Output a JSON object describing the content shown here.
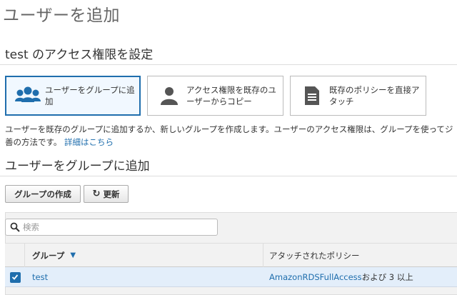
{
  "page": {
    "title": "ユーザーを追加"
  },
  "permissions": {
    "section_title": "test のアクセス権限を設定",
    "options": [
      {
        "label": "ユーザーをグループに追加",
        "icon": "users-group-icon",
        "selected": true
      },
      {
        "label": "アクセス権限を既存のユーザーからコピー",
        "icon": "user-icon",
        "selected": false
      },
      {
        "label": "既存のポリシーを直接アタッチ",
        "icon": "document-icon",
        "selected": false
      }
    ],
    "description_line1": "ユーザーを既存のグループに追加するか、新しいグループを作成します。ユーザーのアクセス権限は、グループを使って",
    "description_cut": "ジ",
    "description_line2": "善の方法です。",
    "details_link": "詳細はこちら"
  },
  "groups": {
    "section_title": "ユーザーをグループに追加",
    "create_button": "グループの作成",
    "refresh_button": "更新",
    "search_placeholder": "検索",
    "columns": {
      "group": "グループ",
      "policies": "アタッチされたポリシー"
    },
    "rows": [
      {
        "group": "test",
        "policy_link": "AmazonRDSFullAccess",
        "policy_suffix": " および 3 以上",
        "checked": true
      }
    ]
  },
  "colors": {
    "accent": "#1f6ead",
    "selected_row": "#e3eefa"
  }
}
